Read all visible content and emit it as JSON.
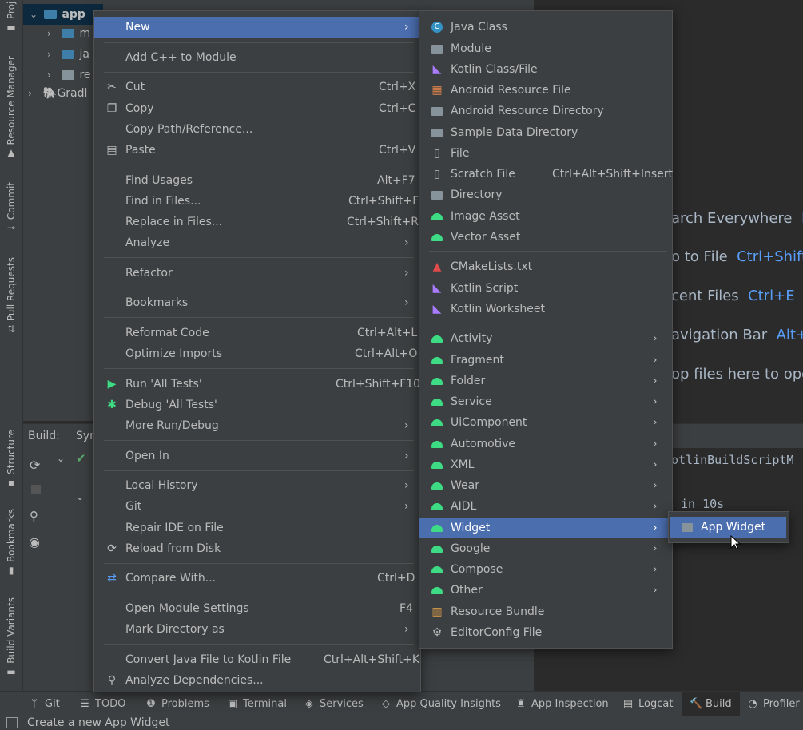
{
  "left_strip": {
    "tabs": [
      "Project",
      "Resource Manager",
      "Commit",
      "Pull Requests",
      "Structure",
      "Bookmarks",
      "Build Variants"
    ]
  },
  "project_tree": {
    "root": "app",
    "children": [
      "m",
      "ja",
      "re"
    ],
    "gradle": "Gradl"
  },
  "editor_hints": [
    {
      "text": "arch Everywhere",
      "key": "D"
    },
    {
      "text": "o to File",
      "key": "Ctrl+Shift"
    },
    {
      "text": "cent Files",
      "key": "Ctrl+E"
    },
    {
      "text": "avigation Bar",
      "key": "Alt+H"
    },
    {
      "text": "op files here to ope",
      "key": ""
    }
  ],
  "build_panel": {
    "tab_label": "Build:",
    "sync_tab": "Syn",
    "log_line1": "otlinBuildScriptM",
    "log_line2": "in 10s"
  },
  "context_menu": {
    "items": [
      {
        "label": "New",
        "shortcut": "",
        "submenu": true,
        "selected": true,
        "icon": ""
      },
      {
        "label": "Add C++ to Module",
        "shortcut": "",
        "icon": ""
      },
      {
        "label": "Cut",
        "shortcut": "Ctrl+X",
        "icon": "scissors-icon"
      },
      {
        "label": "Copy",
        "shortcut": "Ctrl+C",
        "icon": "copy-icon"
      },
      {
        "label": "Copy Path/Reference...",
        "shortcut": "",
        "icon": ""
      },
      {
        "label": "Paste",
        "shortcut": "Ctrl+V",
        "icon": "clipboard-icon"
      },
      {
        "label": "Find Usages",
        "shortcut": "Alt+F7",
        "icon": ""
      },
      {
        "label": "Find in Files...",
        "shortcut": "Ctrl+Shift+F",
        "icon": ""
      },
      {
        "label": "Replace in Files...",
        "shortcut": "Ctrl+Shift+R",
        "icon": ""
      },
      {
        "label": "Analyze",
        "shortcut": "",
        "submenu": true,
        "icon": ""
      },
      {
        "label": "Refactor",
        "shortcut": "",
        "submenu": true,
        "icon": ""
      },
      {
        "label": "Bookmarks",
        "shortcut": "",
        "submenu": true,
        "icon": ""
      },
      {
        "label": "Reformat Code",
        "shortcut": "Ctrl+Alt+L",
        "icon": ""
      },
      {
        "label": "Optimize Imports",
        "shortcut": "Ctrl+Alt+O",
        "icon": ""
      },
      {
        "label": "Run 'All Tests'",
        "shortcut": "Ctrl+Shift+F10",
        "icon": "run-icon"
      },
      {
        "label": "Debug 'All Tests'",
        "shortcut": "",
        "icon": "debug-icon"
      },
      {
        "label": "More Run/Debug",
        "shortcut": "",
        "submenu": true,
        "icon": ""
      },
      {
        "label": "Open In",
        "shortcut": "",
        "submenu": true,
        "icon": ""
      },
      {
        "label": "Local History",
        "shortcut": "",
        "submenu": true,
        "icon": ""
      },
      {
        "label": "Git",
        "shortcut": "",
        "submenu": true,
        "icon": ""
      },
      {
        "label": "Repair IDE on File",
        "shortcut": "",
        "icon": ""
      },
      {
        "label": "Reload from Disk",
        "shortcut": "",
        "icon": "reload-icon"
      },
      {
        "label": "Compare With...",
        "shortcut": "Ctrl+D",
        "icon": "compare-icon"
      },
      {
        "label": "Open Module Settings",
        "shortcut": "F4",
        "icon": ""
      },
      {
        "label": "Mark Directory as",
        "shortcut": "",
        "submenu": true,
        "icon": ""
      },
      {
        "label": "Convert Java File to Kotlin File",
        "shortcut": "Ctrl+Alt+Shift+K",
        "icon": ""
      },
      {
        "label": "Analyze Dependencies...",
        "shortcut": "",
        "icon": "analyze-icon"
      }
    ]
  },
  "new_submenu": {
    "items": [
      {
        "label": "Java Class",
        "shortcut": "",
        "icon": "java-class-icon"
      },
      {
        "label": "Module",
        "shortcut": "",
        "icon": "module-icon"
      },
      {
        "label": "Kotlin Class/File",
        "shortcut": "",
        "icon": "kotlin-file-icon"
      },
      {
        "label": "Android Resource File",
        "shortcut": "",
        "icon": "resource-file-icon"
      },
      {
        "label": "Android Resource Directory",
        "shortcut": "",
        "icon": "folder-icon"
      },
      {
        "label": "Sample Data Directory",
        "shortcut": "",
        "icon": "folder-icon"
      },
      {
        "label": "File",
        "shortcut": "",
        "icon": "file-icon"
      },
      {
        "label": "Scratch File",
        "shortcut": "Ctrl+Alt+Shift+Insert",
        "icon": "scratch-file-icon"
      },
      {
        "label": "Directory",
        "shortcut": "",
        "icon": "folder-icon"
      },
      {
        "label": "Image Asset",
        "shortcut": "",
        "icon": "android-icon"
      },
      {
        "label": "Vector Asset",
        "shortcut": "",
        "icon": "android-icon"
      },
      {
        "label": "CMakeLists.txt",
        "shortcut": "",
        "icon": "cmake-icon"
      },
      {
        "label": "Kotlin Script",
        "shortcut": "",
        "icon": "kotlin-file-icon"
      },
      {
        "label": "Kotlin Worksheet",
        "shortcut": "",
        "icon": "kotlin-file-icon"
      },
      {
        "label": "Activity",
        "submenu": true,
        "icon": "android-icon"
      },
      {
        "label": "Fragment",
        "submenu": true,
        "icon": "android-icon"
      },
      {
        "label": "Folder",
        "submenu": true,
        "icon": "android-icon"
      },
      {
        "label": "Service",
        "submenu": true,
        "icon": "android-icon"
      },
      {
        "label": "UiComponent",
        "submenu": true,
        "icon": "android-icon"
      },
      {
        "label": "Automotive",
        "submenu": true,
        "icon": "android-icon"
      },
      {
        "label": "XML",
        "submenu": true,
        "icon": "android-icon"
      },
      {
        "label": "Wear",
        "submenu": true,
        "icon": "android-icon"
      },
      {
        "label": "AIDL",
        "submenu": true,
        "icon": "android-icon"
      },
      {
        "label": "Widget",
        "submenu": true,
        "selected": true,
        "icon": "android-icon"
      },
      {
        "label": "Google",
        "submenu": true,
        "icon": "android-icon"
      },
      {
        "label": "Compose",
        "submenu": true,
        "icon": "android-icon"
      },
      {
        "label": "Other",
        "submenu": true,
        "icon": "android-icon"
      },
      {
        "label": "Resource Bundle",
        "shortcut": "",
        "icon": "resource-bundle-icon"
      },
      {
        "label": "EditorConfig File",
        "shortcut": "",
        "icon": "gear-icon"
      }
    ]
  },
  "widget_submenu": {
    "items": [
      {
        "label": "App Widget",
        "icon": "app-widget-icon",
        "selected": true
      }
    ]
  },
  "bottom_tools": [
    {
      "label": "Git",
      "icon": "git-icon"
    },
    {
      "label": "TODO",
      "icon": "todo-icon"
    },
    {
      "label": "Problems",
      "icon": "problems-icon"
    },
    {
      "label": "Terminal",
      "icon": "terminal-icon"
    },
    {
      "label": "Services",
      "icon": "services-icon"
    },
    {
      "label": "App Quality Insights",
      "icon": "app-quality-icon"
    },
    {
      "label": "App Inspection",
      "icon": "app-inspection-icon"
    },
    {
      "label": "Logcat",
      "icon": "logcat-icon"
    },
    {
      "label": "Build",
      "icon": "build-hammer-icon",
      "active": true
    },
    {
      "label": "Profiler",
      "icon": "profiler-icon"
    }
  ],
  "status_bar": {
    "text": "Create a new App Widget"
  },
  "colors": {
    "selection": "#4b6eaf",
    "android_green": "#3ddc84",
    "link_blue": "#589df6",
    "panel": "#3c3f41",
    "editor": "#2b2b2b"
  }
}
